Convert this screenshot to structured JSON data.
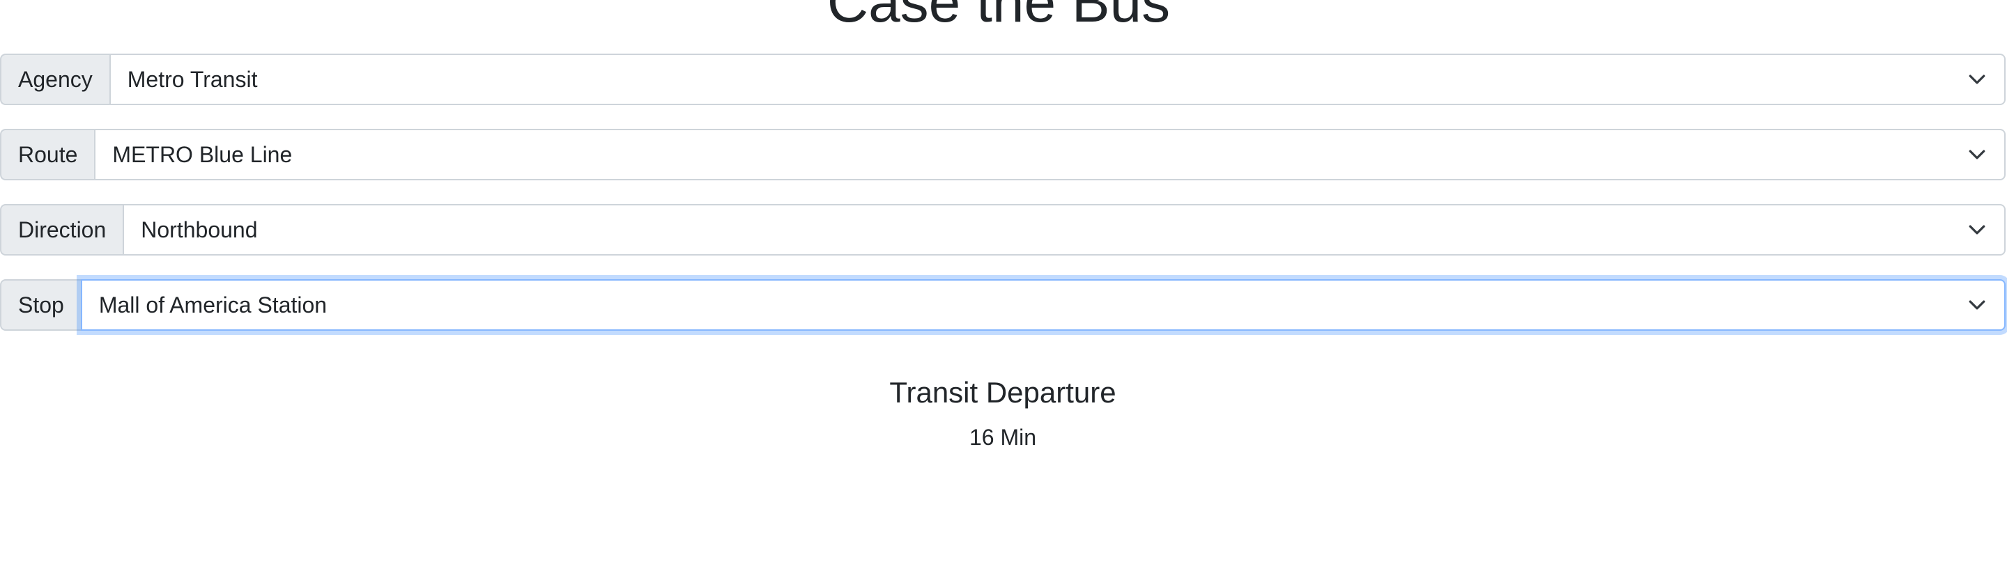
{
  "page_title": "Case the Bus",
  "form": {
    "agency": {
      "label": "Agency",
      "value": "Metro Transit"
    },
    "route": {
      "label": "Route",
      "value": "METRO Blue Line"
    },
    "direction": {
      "label": "Direction",
      "value": "Northbound"
    },
    "stop": {
      "label": "Stop",
      "value": "Mall of America Station"
    }
  },
  "departure": {
    "title": "Transit Departure",
    "value": "16 Min"
  },
  "icons": {
    "dropdown": "chevron-down-icon"
  },
  "colors": {
    "text": "#212529",
    "label_bg": "#e9ecef",
    "border": "#ced4da",
    "focus_border": "#86b7fe"
  }
}
